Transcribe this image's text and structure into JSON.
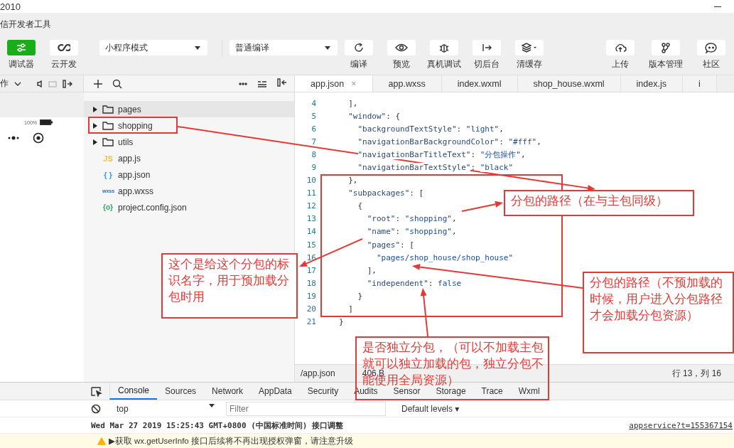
{
  "window": {
    "title": "2010",
    "app_title": "信开发者工具"
  },
  "toolbar": {
    "left": [
      {
        "kind": "debugger",
        "label": "调试器",
        "on": true
      },
      {
        "kind": "cloud",
        "label": "云开发",
        "on": false
      }
    ],
    "mode_select": {
      "value": "小程序模式"
    },
    "compile_select": {
      "value": "普通编译"
    },
    "actions": [
      {
        "kind": "refresh",
        "label": "编译"
      },
      {
        "kind": "eye",
        "label": "预览"
      },
      {
        "kind": "bug",
        "label": "真机调试"
      },
      {
        "kind": "switch",
        "label": "切后台"
      },
      {
        "kind": "layers",
        "label": "清缓存"
      }
    ],
    "right": [
      {
        "kind": "upload",
        "label": "上传"
      },
      {
        "kind": "branch",
        "label": "版本管理"
      },
      {
        "kind": "chat",
        "label": "社区"
      }
    ]
  },
  "simulator": {
    "menu_label": "作",
    "battery": "100%"
  },
  "file_tree": [
    {
      "kind": "folder",
      "name": "pages",
      "selected": true
    },
    {
      "kind": "folder",
      "name": "shopping",
      "selected": false
    },
    {
      "kind": "folder",
      "name": "utils",
      "selected": false
    },
    {
      "kind": "js",
      "icon": "JS",
      "name": "app.js",
      "selected": false
    },
    {
      "kind": "json",
      "icon": "{ }",
      "name": "app.json",
      "selected": false
    },
    {
      "kind": "wxss",
      "icon": "wxss",
      "name": "app.wxss",
      "selected": false
    },
    {
      "kind": "config",
      "icon": "{o}",
      "name": "project.config.json",
      "selected": false
    }
  ],
  "editor": {
    "tabs": [
      {
        "label": "app.json",
        "selected": true,
        "close": "×"
      },
      {
        "label": "app.wxss",
        "selected": false
      },
      {
        "label": "index.wxml",
        "selected": false
      },
      {
        "label": "shop_house.wxml",
        "selected": false
      },
      {
        "label": "index.js",
        "selected": false
      },
      {
        "label": "i",
        "selected": false
      }
    ],
    "lines": [
      {
        "number": "4",
        "code": "  ],"
      },
      {
        "number": "5",
        "code": "  \"window\": {"
      },
      {
        "number": "6",
        "code": "    \"backgroundTextStyle\": \"light\","
      },
      {
        "number": "7",
        "code": "    \"navigationBarBackgroundColor\": \"#fff\","
      },
      {
        "number": "8",
        "code": "    \"navigationBarTitleText\": \"分包操作\","
      },
      {
        "number": "9",
        "code": "    \"navigationBarTextStyle\": \"black\""
      },
      {
        "number": "10",
        "code": "  },"
      },
      {
        "number": "11",
        "code": "  \"subpackages\": ["
      },
      {
        "number": "12",
        "code": "    {"
      },
      {
        "number": "13",
        "code": "      \"root\": \"shopping\","
      },
      {
        "number": "14",
        "code": "      \"name\": \"shopping\","
      },
      {
        "number": "15",
        "code": "      \"pages\": ["
      },
      {
        "number": "16",
        "code": "        \"pages/shop_house/shop_house\""
      },
      {
        "number": "17",
        "code": "      ],"
      },
      {
        "number": "18",
        "code": "      \"independent\": false"
      },
      {
        "number": "19",
        "code": "    }"
      },
      {
        "number": "20",
        "code": "  ]"
      },
      {
        "number": "21",
        "code": "}"
      }
    ],
    "status": {
      "path": "/app.json",
      "size": "406 B",
      "cursor": "行 13，列 16"
    }
  },
  "devtools": {
    "tabs": [
      {
        "label": "Console",
        "selected": true
      },
      {
        "label": "Sources",
        "selected": false
      },
      {
        "label": "Network",
        "selected": false
      },
      {
        "label": "AppData",
        "selected": false
      },
      {
        "label": "Security",
        "selected": false
      },
      {
        "label": "Audits",
        "selected": false
      },
      {
        "label": "Sensor",
        "selected": false
      },
      {
        "label": "Storage",
        "selected": false
      },
      {
        "label": "Trace",
        "selected": false
      },
      {
        "label": "Wxml",
        "selected": false
      }
    ],
    "context": "top",
    "filter": {
      "placeholder": "Filter"
    },
    "levels": "Default levels ▾",
    "log": {
      "text": "Wed Mar 27 2019 15:25:43 GMT+0800 (中国标准时间) 接口调整",
      "source": "appservice?t=155367154"
    },
    "warning": {
      "text": "▶获取 wx.getUserInfo 接口后续将不再出现授权弹窗，请注意升级"
    }
  },
  "annotations": [
    {
      "kind": "frame"
    },
    {
      "kind": "frame"
    },
    {
      "kind": "note",
      "text": "分包的路径（在与主包同级）"
    },
    {
      "kind": "note",
      "text": "这个是给这个分包的标识名字，用于预加载分包时用"
    },
    {
      "kind": "note",
      "text": "分包的路径（不预加载的时候，用户进入分包路径才会加载分包资源）"
    },
    {
      "kind": "note",
      "text": "是否独立分包，（可以不加载主包就可以独立加载的包，独立分包不能使用全局资源）"
    }
  ]
}
